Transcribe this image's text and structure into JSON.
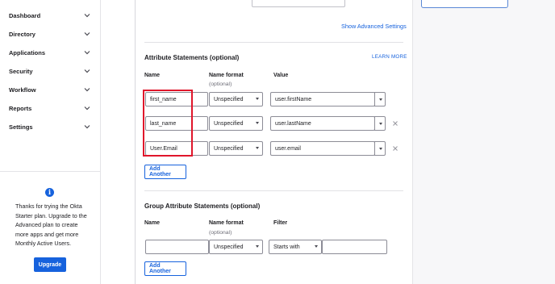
{
  "sidebar": {
    "items": [
      {
        "label": "Dashboard"
      },
      {
        "label": "Directory"
      },
      {
        "label": "Applications"
      },
      {
        "label": "Security"
      },
      {
        "label": "Workflow"
      },
      {
        "label": "Reports"
      },
      {
        "label": "Settings"
      }
    ],
    "promo": {
      "icon": "info-icon",
      "text": "Thanks for trying the Okta Starter plan. Upgrade to the Advanced plan to create more apps and get more Monthly Active Users.",
      "upgrade_label": "Upgrade"
    }
  },
  "main": {
    "show_advanced_label": "Show Advanced Settings",
    "attribute_statements": {
      "title": "Attribute Statements (optional)",
      "learn_more": "LEARN MORE",
      "col_name": "Name",
      "col_format": "Name format",
      "col_format_sub": "(optional)",
      "col_value": "Value",
      "rows": [
        {
          "name": "first_name",
          "format": "Unspecified",
          "value": "user.firstName",
          "removable": false
        },
        {
          "name": "last_name",
          "format": "Unspecified",
          "value": "user.lastName",
          "removable": true
        },
        {
          "name": "User.Email",
          "format": "Unspecified",
          "value": "user.email",
          "removable": true
        }
      ],
      "add_label": "Add Another"
    },
    "group_statements": {
      "title": "Group Attribute Statements (optional)",
      "col_name": "Name",
      "col_format": "Name format",
      "col_format_sub": "(optional)",
      "col_filter": "Filter",
      "row": {
        "name": "",
        "format": "Unspecified",
        "filter_type": "Starts with",
        "filter_value": ""
      },
      "add_label": "Add Another"
    }
  },
  "colors": {
    "accent": "#1662dd",
    "highlight": "#e0162b"
  }
}
